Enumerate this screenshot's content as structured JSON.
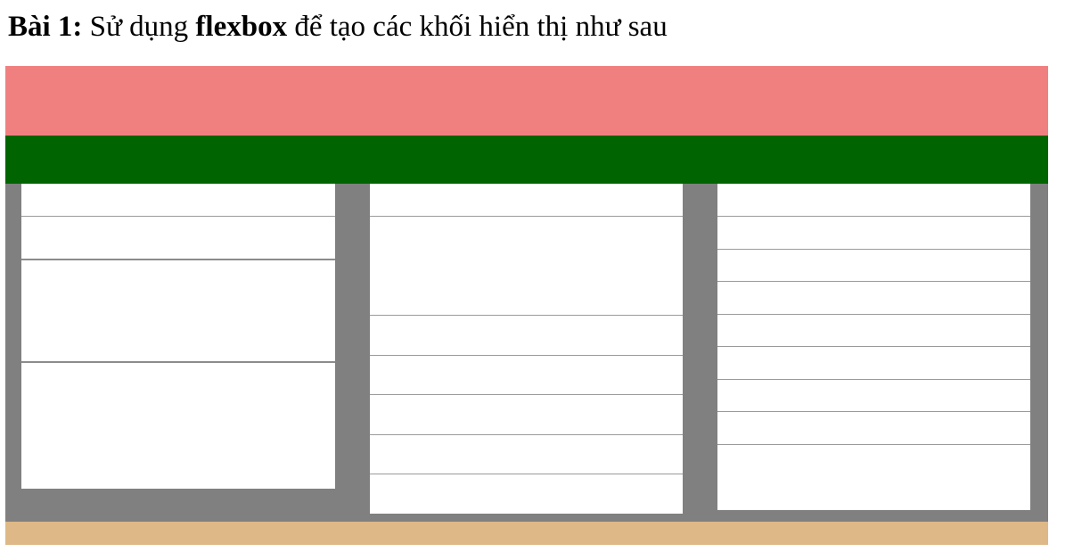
{
  "heading": {
    "label": "Bài 1:",
    "text_before": " Sử dụng ",
    "keyword": "flexbox",
    "text_after": " để tạo các khối hiển thị như sau"
  },
  "colors": {
    "header": "#f08080",
    "navbar": "#006400",
    "main": "#808080",
    "column": "#ffffff",
    "footer": "#deb887"
  }
}
